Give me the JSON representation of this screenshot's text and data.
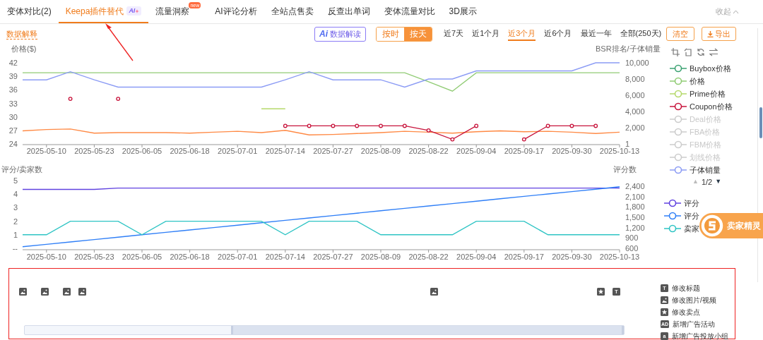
{
  "tabs": [
    {
      "label": "变体对比(2)",
      "selected": false
    },
    {
      "label": "Keepa插件替代",
      "selected": true,
      "badge": {
        "kind": "ai",
        "text": "AI"
      }
    },
    {
      "label": "流量洞察",
      "selected": false,
      "badge": {
        "kind": "new",
        "text": "new"
      }
    },
    {
      "label": "AI评论分析",
      "selected": false
    },
    {
      "label": "全站点售卖",
      "selected": false
    },
    {
      "label": "反查出单词",
      "selected": false
    },
    {
      "label": "变体流量对比",
      "selected": false
    },
    {
      "label": "3D展示",
      "selected": false
    }
  ],
  "collapse": "收起",
  "toolbar": {
    "explain_link": "数据解释",
    "ai_button": {
      "icon_text": "Ai",
      "label": "数据解读"
    },
    "granularity": [
      {
        "label": "按时",
        "selected": false
      },
      {
        "label": "按天",
        "selected": true
      }
    ],
    "ranges": [
      {
        "label": "近7天",
        "selected": false
      },
      {
        "label": "近1个月",
        "selected": false
      },
      {
        "label": "近3个月",
        "selected": true
      },
      {
        "label": "近6个月",
        "selected": false
      },
      {
        "label": "最近一年",
        "selected": false
      },
      {
        "label": "全部(250天)",
        "selected": false
      }
    ],
    "clear_button": "清空",
    "export_button": "导出"
  },
  "price_chart": {
    "chart_data": {
      "type": "line",
      "ylabel": "价格($)",
      "y2label": "BSR排名/子体销量",
      "categories": [
        null,
        "2025-05-10",
        null,
        "2025-05-23",
        null,
        "2025-06-05",
        null,
        "2025-06-18",
        null,
        "2025-07-01",
        null,
        "2025-07-14",
        null,
        "2025-07-27",
        null,
        "2025-08-09",
        null,
        "2025-08-22",
        null,
        "2025-09-04",
        null,
        "2025-09-17",
        null,
        "2025-09-30",
        null,
        "2025-10-13"
      ],
      "ylim": [
        24,
        42
      ],
      "yticks": [
        24,
        27,
        30,
        33,
        36,
        39,
        42
      ],
      "y2lim": [
        1,
        10000
      ],
      "y2ticks": [
        {
          "value": 1,
          "label": "1"
        },
        {
          "value": 2000,
          "label": "2,000"
        },
        {
          "value": 4000,
          "label": "4,000"
        },
        {
          "value": 6000,
          "label": "6,000"
        },
        {
          "value": 8000,
          "label": "8,000"
        },
        {
          "value": 10000,
          "label": "10,000"
        }
      ],
      "series": [
        {
          "color": "#91cc75",
          "values": [
            39.8,
            39.8,
            39.8,
            39.8,
            39.8,
            39.8,
            39.8,
            39.8,
            39.8,
            39.8,
            39.8,
            39.8,
            39.8,
            39.8,
            39.8,
            39.8,
            39.8,
            37.8,
            35.7,
            39.8,
            39.8,
            39.8,
            39.8,
            39.8,
            39.8,
            39.8
          ]
        },
        {
          "color": "#b5d96b",
          "values": [
            null,
            null,
            null,
            null,
            null,
            null,
            null,
            null,
            null,
            null,
            31.8,
            31.8,
            null,
            null,
            null,
            null,
            null,
            null,
            null,
            null,
            null,
            null,
            null,
            null,
            null,
            null
          ]
        },
        {
          "color": "#8c9cf5",
          "axis": "y2",
          "values": [
            7900,
            7900,
            8900,
            7900,
            7000,
            7000,
            7000,
            7000,
            7000,
            7000,
            7000,
            7900,
            8900,
            7900,
            7900,
            7900,
            7000,
            8000,
            8000,
            9000,
            9000,
            9000,
            9000,
            9000,
            10000,
            10000
          ]
        },
        {
          "color": "#ff8a45",
          "values": [
            26.9,
            27.2,
            27.3,
            26.4,
            26.5,
            26.5,
            26.5,
            26.4,
            26.6,
            26.8,
            26.5,
            27.0,
            26.0,
            26.1,
            26.3,
            26.5,
            26.8,
            26.6,
            26.4,
            26.7,
            26.9,
            26.7,
            26.8,
            26.6,
            26.3,
            26.6
          ]
        },
        {
          "color": "#c8143c",
          "marker": true,
          "values": [
            null,
            null,
            34,
            null,
            34,
            null,
            null,
            null,
            null,
            null,
            null,
            28,
            28,
            28,
            28,
            28,
            28,
            27,
            25,
            28,
            null,
            25,
            28,
            28,
            28,
            null
          ]
        }
      ]
    }
  },
  "rating_chart": {
    "chart_data": {
      "type": "line",
      "ylabel": "评分/卖家数",
      "y2label": "评分数",
      "categories": [
        null,
        "2025-05-10",
        null,
        "2025-05-23",
        null,
        "2025-06-05",
        null,
        "2025-06-18",
        null,
        "2025-07-01",
        null,
        "2025-07-14",
        null,
        "2025-07-27",
        null,
        "2025-08-09",
        null,
        "2025-08-22",
        null,
        "2025-09-04",
        null,
        "2025-09-17",
        null,
        "2025-09-30",
        null,
        "2025-10-13"
      ],
      "ylim": [
        0,
        5
      ],
      "yticks": [
        {
          "value": 0,
          "label": "--"
        },
        1,
        2,
        3,
        4,
        5
      ],
      "y2lim": [
        600,
        2400
      ],
      "y2ticks": [
        {
          "value": 600,
          "label": "600"
        },
        {
          "value": 900,
          "label": "900"
        },
        {
          "value": 1200,
          "label": "1,200"
        },
        {
          "value": 1500,
          "label": "1,500"
        },
        {
          "value": 1800,
          "label": "1,800"
        },
        {
          "value": 2100,
          "label": "2,100"
        },
        {
          "value": 2400,
          "label": "2,400"
        }
      ],
      "series": [
        {
          "color": "#6042e0",
          "values": [
            4.35,
            4.35,
            4.35,
            4.35,
            4.45,
            4.45,
            4.45,
            4.45,
            4.45,
            4.45,
            4.45,
            4.45,
            4.45,
            4.45,
            4.45,
            4.45,
            4.45,
            4.45,
            4.45,
            4.45,
            4.45,
            4.45,
            4.45,
            4.45,
            4.45,
            4.45
          ]
        },
        {
          "color": "#2f7ff7",
          "axis": "y2",
          "values": [
            645,
            714,
            784,
            853,
            923,
            992,
            1062,
            1132,
            1201,
            1271,
            1340,
            1410,
            1479,
            1549,
            1618,
            1688,
            1757,
            1827,
            1897,
            1966,
            2036,
            2105,
            2175,
            2244,
            2314,
            2383
          ]
        },
        {
          "color": "#2ec4c4",
          "values": [
            1,
            1,
            2,
            2,
            2,
            1,
            2,
            2,
            2,
            2,
            2,
            1,
            2,
            2,
            2,
            1,
            1,
            1,
            1,
            2,
            2,
            2,
            1,
            1,
            1,
            1
          ]
        }
      ]
    }
  },
  "legend": {
    "items": [
      {
        "label": "Buybox价格",
        "color": "#3ba272",
        "on": true
      },
      {
        "label": "价格",
        "color": "#91cc75",
        "on": true
      },
      {
        "label": "Prime价格",
        "color": "#b5d96b",
        "on": true
      },
      {
        "label": "Coupon价格",
        "color": "#c8143c",
        "on": true
      },
      {
        "label": "Deal价格",
        "color": "#cccccc",
        "on": false
      },
      {
        "label": "FBA价格",
        "color": "#cccccc",
        "on": false
      },
      {
        "label": "FBM价格",
        "color": "#cccccc",
        "on": false
      },
      {
        "label": "划线价格",
        "color": "#cccccc",
        "on": false
      },
      {
        "label": "子体销量",
        "color": "#8c9cf5",
        "on": true
      }
    ],
    "pager": {
      "prev": "▲",
      "text": "1/2",
      "next": "▼",
      "prev_disabled": true
    }
  },
  "legend2": [
    {
      "label": "评分",
      "color": "#6042e0",
      "on": true
    },
    {
      "label": "评分",
      "color": "#2f7ff7",
      "on": true
    },
    {
      "label": "卖家",
      "color": "#2ec4c4",
      "on": true
    }
  ],
  "widget": {
    "label": "卖家精灵"
  },
  "changes": {
    "events": [
      {
        "kind": "image"
      },
      {
        "kind": "image"
      },
      {
        "kind": "image"
      },
      {
        "kind": "image"
      },
      {
        "kind": "image"
      },
      {
        "kind": "star"
      },
      {
        "kind": "title",
        "icon_text": "T"
      }
    ],
    "range": {
      "level": 0.656
    },
    "legend": [
      {
        "kind": "title",
        "icon_text": "T",
        "label": "修改标题"
      },
      {
        "kind": "image",
        "label": "修改图片/视频"
      },
      {
        "kind": "star",
        "label": "修改卖点"
      },
      {
        "kind": "ad",
        "icon_text": "AD",
        "label": "新增广告活动"
      },
      {
        "kind": "group",
        "icon_text": "a",
        "label": "新增广告投放小组"
      }
    ]
  }
}
